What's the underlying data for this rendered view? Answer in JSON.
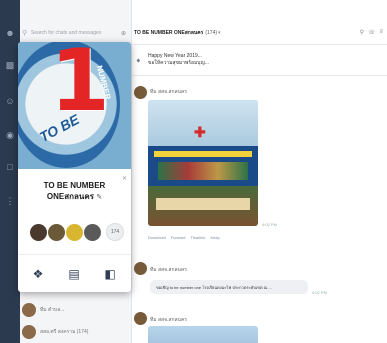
{
  "search": {
    "placeholder": "Search for chats and messages"
  },
  "chat": {
    "title": "TO BE NUMBER ONEสกลนคร",
    "member_count": "(174)",
    "announcement_line1": "Happy New Year 2019...",
    "announcement_line2": "ขอให้ความสุขมาพร้อมบุญ..."
  },
  "profile": {
    "name_line1": "TO BE NUMBER",
    "name_line2": "ONEสกลนคร",
    "members_more": "174",
    "cover_number": "1",
    "cover_to_be": "TO BE",
    "cover_number_text": "NUMBER"
  },
  "messages": [
    {
      "sender": "ทีม สสจ.สกลนคร",
      "time": "4:02 PM"
    },
    {
      "sender": "ทีม สสจ.สกลนคร",
      "text": "ขอเชิญ to be number one โรงเรียนดงมะไฟ ประกวดระดับเขต ณ ...",
      "time": "4:02 PM"
    },
    {
      "sender": "ทีม สสจ.สกลนคร"
    }
  ],
  "photo_actions": [
    "Download",
    "Forward",
    "Timeline",
    "Keep"
  ],
  "list_partial": [
    {
      "name": "ทีม ตำบล..."
    },
    {
      "name": "สสอ.ศรี สงคราม (174)"
    }
  ],
  "colors": {
    "rail": "#2c3a4f",
    "accent": "#e32525",
    "brand_blue": "#1e5b96"
  }
}
